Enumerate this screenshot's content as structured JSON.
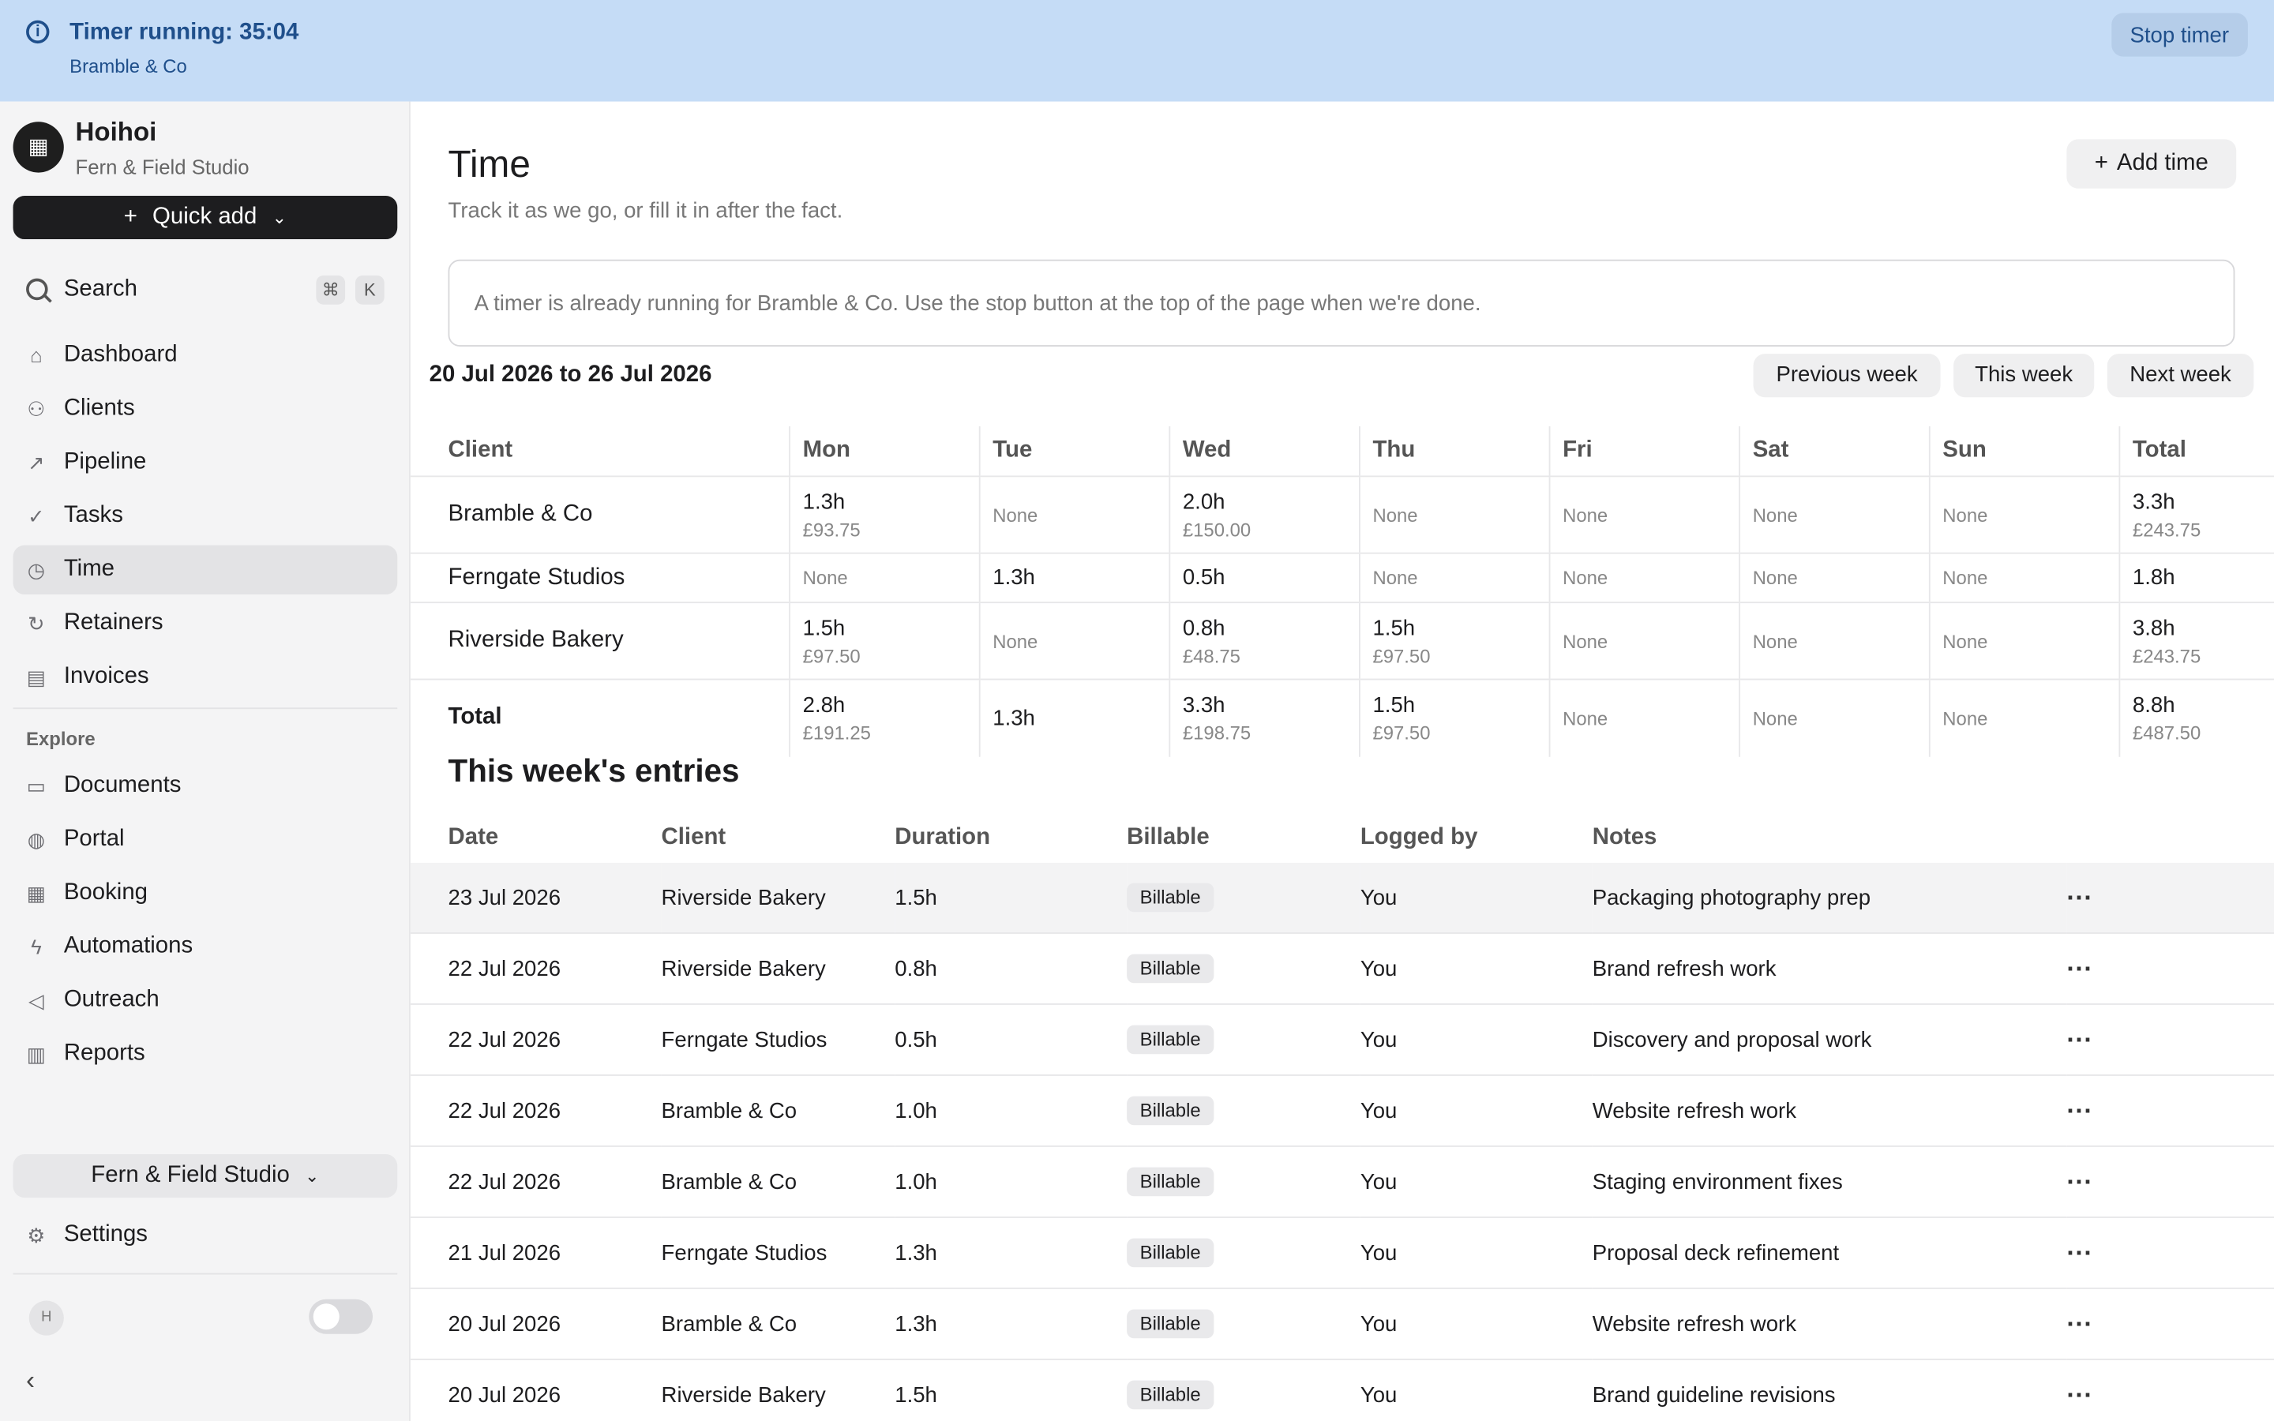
{
  "banner": {
    "title": "Timer running: 35:04",
    "client": "Bramble & Co",
    "stop_label": "Stop timer",
    "color": "#c5dcf6"
  },
  "sidebar": {
    "workspace_name": "Hoihoi",
    "workspace_sub": "Fern & Field Studio",
    "quick_add": "Quick add",
    "search_label": "Search",
    "search_keys": [
      "⌘",
      "K"
    ],
    "items": [
      {
        "label": "Dashboard",
        "icon": "home-icon"
      },
      {
        "label": "Clients",
        "icon": "users-icon"
      },
      {
        "label": "Pipeline",
        "icon": "trend-icon"
      },
      {
        "label": "Tasks",
        "icon": "check-circle-icon"
      },
      {
        "label": "Time",
        "icon": "clock-icon",
        "active": true
      },
      {
        "label": "Retainers",
        "icon": "refresh-icon"
      },
      {
        "label": "Invoices",
        "icon": "document-icon"
      }
    ],
    "explore_label": "Explore",
    "explore_items": [
      {
        "label": "Documents",
        "icon": "folder-icon"
      },
      {
        "label": "Portal",
        "icon": "globe-icon"
      },
      {
        "label": "Booking",
        "icon": "calendar-icon"
      },
      {
        "label": "Automations",
        "icon": "bolt-icon"
      },
      {
        "label": "Outreach",
        "icon": "megaphone-icon"
      },
      {
        "label": "Reports",
        "icon": "bar-chart-icon"
      }
    ],
    "studio_select": "Fern & Field Studio",
    "settings_label": "Settings",
    "avatar_initial": "H"
  },
  "main": {
    "title": "Time",
    "description": "Track it as we go, or fill it in after the fact.",
    "add_time": "Add time",
    "notice": "A timer is already running for Bramble & Co. Use the stop button at the top of the page when we're done.",
    "range": "20 Jul 2026 to 26 Jul 2026",
    "week_buttons": [
      "Previous week",
      "This week",
      "Next week"
    ]
  },
  "summary": {
    "headers": [
      "Client",
      "Mon",
      "Tue",
      "Wed",
      "Thu",
      "Fri",
      "Sat",
      "Sun",
      "Total"
    ],
    "rows": [
      {
        "client": "Bramble & Co",
        "cells": [
          {
            "h": "1.3h",
            "a": "£93.75"
          },
          {
            "none": "None"
          },
          {
            "h": "2.0h",
            "a": "£150.00"
          },
          {
            "none": "None"
          },
          {
            "none": "None"
          },
          {
            "none": "None"
          },
          {
            "none": "None"
          },
          {
            "h": "3.3h",
            "a": "£243.75"
          }
        ]
      },
      {
        "client": "Ferngate Studios",
        "cells": [
          {
            "none": "None"
          },
          {
            "h": "1.3h"
          },
          {
            "h": "0.5h"
          },
          {
            "none": "None"
          },
          {
            "none": "None"
          },
          {
            "none": "None"
          },
          {
            "none": "None"
          },
          {
            "h": "1.8h"
          }
        ]
      },
      {
        "client": "Riverside Bakery",
        "cells": [
          {
            "h": "1.5h",
            "a": "£97.50"
          },
          {
            "none": "None"
          },
          {
            "h": "0.8h",
            "a": "£48.75"
          },
          {
            "h": "1.5h",
            "a": "£97.50"
          },
          {
            "none": "None"
          },
          {
            "none": "None"
          },
          {
            "none": "None"
          },
          {
            "h": "3.8h",
            "a": "£243.75"
          }
        ]
      },
      {
        "client": "Total",
        "total": true,
        "cells": [
          {
            "h": "2.8h",
            "a": "£191.25"
          },
          {
            "h": "1.3h"
          },
          {
            "h": "3.3h",
            "a": "£198.75"
          },
          {
            "h": "1.5h",
            "a": "£97.50"
          },
          {
            "none": "None"
          },
          {
            "none": "None"
          },
          {
            "none": "None"
          },
          {
            "h": "8.8h",
            "a": "£487.50"
          }
        ]
      }
    ]
  },
  "entries": {
    "title": "This week's entries",
    "headers": [
      "Date",
      "Client",
      "Duration",
      "Billable",
      "Logged by",
      "Notes"
    ],
    "rows": [
      {
        "date": "23 Jul 2026",
        "client": "Riverside Bakery",
        "duration": "1.5h",
        "billable": "Billable",
        "by": "You",
        "notes": "Packaging photography prep",
        "highlight": true
      },
      {
        "date": "22 Jul 2026",
        "client": "Riverside Bakery",
        "duration": "0.8h",
        "billable": "Billable",
        "by": "You",
        "notes": "Brand refresh work"
      },
      {
        "date": "22 Jul 2026",
        "client": "Ferngate Studios",
        "duration": "0.5h",
        "billable": "Billable",
        "by": "You",
        "notes": "Discovery and proposal work"
      },
      {
        "date": "22 Jul 2026",
        "client": "Bramble & Co",
        "duration": "1.0h",
        "billable": "Billable",
        "by": "You",
        "notes": "Website refresh work"
      },
      {
        "date": "22 Jul 2026",
        "client": "Bramble & Co",
        "duration": "1.0h",
        "billable": "Billable",
        "by": "You",
        "notes": "Staging environment fixes"
      },
      {
        "date": "21 Jul 2026",
        "client": "Ferngate Studios",
        "duration": "1.3h",
        "billable": "Billable",
        "by": "You",
        "notes": "Proposal deck refinement"
      },
      {
        "date": "20 Jul 2026",
        "client": "Bramble & Co",
        "duration": "1.3h",
        "billable": "Billable",
        "by": "You",
        "notes": "Website refresh work"
      },
      {
        "date": "20 Jul 2026",
        "client": "Riverside Bakery",
        "duration": "1.5h",
        "billable": "Billable",
        "by": "You",
        "notes": "Brand guideline revisions"
      }
    ]
  }
}
